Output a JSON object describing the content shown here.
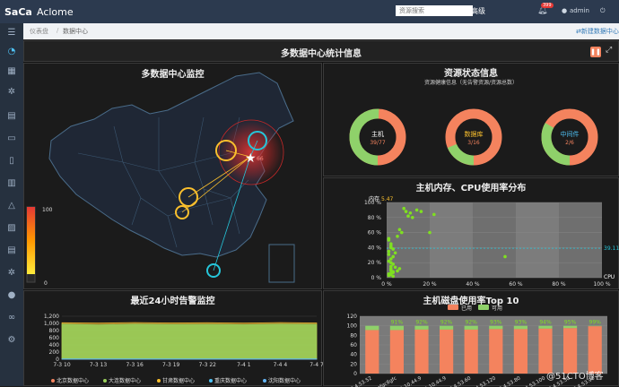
{
  "brand": {
    "logo_small": "SaCa",
    "logo_main": "Aclome"
  },
  "topbar": {
    "search_placeholder": "资源搜索",
    "advanced_label": "高级",
    "notification_count": "399",
    "user_name": "admin",
    "logout_label": "退出"
  },
  "breadcrumb": {
    "item1": "仪表盘",
    "item2": "数据中心",
    "action": "⇄新建数据中心"
  },
  "dashboard": {
    "title": "多数据中心统计信息"
  },
  "map_panel": {
    "title": "多数据中心监控",
    "scale_max": "100",
    "scale_min": "0",
    "selected_label": "66"
  },
  "resource_panel": {
    "title": "资源状态信息",
    "subtitle": "资源健康信息（无告警资源/资源总数）",
    "donuts": [
      {
        "label": "主机",
        "value": "39/77",
        "ok": 39,
        "total": 77
      },
      {
        "label": "数据库",
        "value": "3/16",
        "ok": 3,
        "total": 16
      },
      {
        "label": "中间件",
        "value": "2/6",
        "ok": 2,
        "total": 6
      }
    ]
  },
  "colors": {
    "ok": "#8fd16a",
    "alarm": "#f4835e",
    "accent": "#26c6da",
    "bar_bg": "#7a7a7a",
    "series_green": "#9ad05b"
  },
  "scatter_panel": {
    "title": "主机内存、CPU使用率分布",
    "memory_label": "内存",
    "memory_marker": "5.47",
    "cpu_label": "CPU",
    "avg_value": "39.11"
  },
  "alarm_panel": {
    "title": "最近24小时告警监控",
    "legend": [
      "北京数据中心",
      "大连数据中心",
      "甘肃数据中心",
      "重庆数据中心",
      "沈阳数据中心"
    ]
  },
  "disk_panel": {
    "title": "主机磁盘使用率Top 10",
    "legend_used": "已用",
    "legend_free": "可用",
    "watermark": "@51CTO博客"
  },
  "chart_data": [
    {
      "type": "pie",
      "title": "资源状态信息",
      "series": [
        {
          "name": "主机",
          "values": [
            39,
            38
          ]
        },
        {
          "name": "数据库",
          "values": [
            3,
            13
          ]
        },
        {
          "name": "中间件",
          "values": [
            2,
            4
          ]
        }
      ]
    },
    {
      "type": "scatter",
      "title": "主机内存、CPU使用率分布",
      "xlabel": "CPU",
      "ylabel": "内存",
      "xlim": [
        0,
        100
      ],
      "ylim": [
        0,
        100
      ],
      "xticks": [
        "0 %",
        "20 %",
        "40 %",
        "60 %",
        "80 %",
        "100 %"
      ],
      "yticks": [
        "0 %",
        "20 %",
        "40 %",
        "60 %",
        "80 %",
        "100 %"
      ],
      "avg_line": 39.11,
      "x": [
        1,
        2,
        2,
        3,
        1,
        2,
        4,
        1,
        2,
        3,
        1,
        2,
        1,
        3,
        2,
        5,
        7,
        6,
        8,
        9,
        10,
        11,
        12,
        14,
        16,
        20,
        22,
        55,
        3,
        2,
        1,
        2,
        3,
        4,
        6,
        2,
        1,
        3,
        5,
        2
      ],
      "y": [
        5,
        12,
        20,
        28,
        35,
        40,
        33,
        22,
        15,
        8,
        3,
        45,
        50,
        2,
        10,
        55,
        60,
        64,
        92,
        88,
        82,
        86,
        80,
        90,
        88,
        60,
        84,
        28,
        18,
        25,
        31,
        6,
        38,
        14,
        12,
        42,
        52,
        7,
        9,
        4
      ]
    },
    {
      "type": "area",
      "title": "最近24小时告警监控",
      "categories": [
        "7-3 10",
        "7-3 13",
        "7-3 16",
        "7-3 19",
        "7-3 22",
        "7-4 1",
        "7-4 4",
        "7-4 7"
      ],
      "yticks": [
        0,
        200,
        400,
        600,
        800,
        1000,
        1200
      ],
      "ylim": [
        0,
        1200
      ],
      "series": [
        {
          "name": "北京数据中心",
          "values": [
            5,
            5,
            5,
            5,
            5,
            5,
            5,
            5
          ]
        },
        {
          "name": "大连数据中心",
          "values": [
            980,
            960,
            980,
            970,
            975,
            965,
            980,
            975
          ]
        },
        {
          "name": "甘肃数据中心",
          "values": [
            1020,
            1010,
            1025,
            1015,
            1020,
            1010,
            1025,
            1015
          ]
        },
        {
          "name": "重庆数据中心",
          "values": [
            10,
            10,
            10,
            10,
            10,
            10,
            10,
            10
          ]
        },
        {
          "name": "沈阳数据中心",
          "values": [
            3,
            3,
            3,
            3,
            3,
            3,
            3,
            3
          ]
        }
      ]
    },
    {
      "type": "bar",
      "title": "主机磁盘使用率Top 10",
      "categories": [
        "10.4.53.52",
        "datagip8gfgc8gfc",
        "HOST_10.44.9",
        "HOST_10.44.9",
        "10.4.53.60",
        "10.4.53.120",
        "10.4.53.80",
        "10.4.53.100",
        "10.4.53.50",
        "10.4.53.90"
      ],
      "yticks": [
        0,
        20,
        40,
        60,
        80,
        100,
        120
      ],
      "ylim": [
        0,
        120
      ],
      "series": [
        {
          "name": "已用",
          "values": [
            91,
            91,
            92,
            92,
            92,
            93,
            93,
            94,
            95,
            99
          ]
        },
        {
          "name": "可用",
          "values": [
            9,
            9,
            8,
            8,
            8,
            7,
            7,
            6,
            5,
            1
          ]
        }
      ],
      "data_labels": [
        "",
        "91%",
        "92%",
        "92%",
        "92%",
        "93%",
        "93%",
        "94%",
        "95%",
        "99%"
      ]
    }
  ]
}
